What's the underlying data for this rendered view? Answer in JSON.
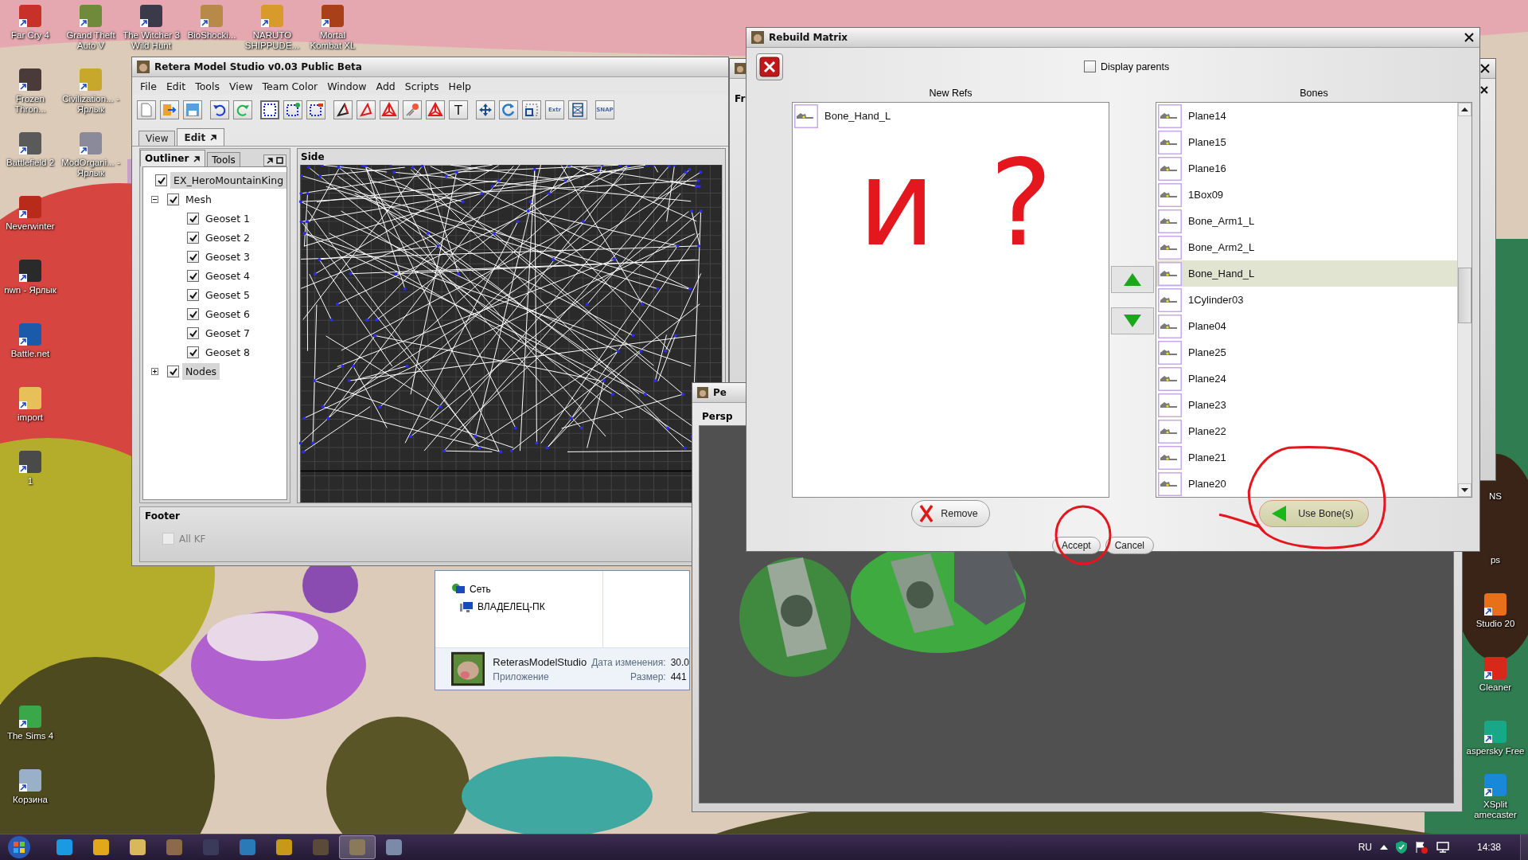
{
  "desktop_icons": [
    {
      "label": "Far Cry 4",
      "color": "#c8302a"
    },
    {
      "label": "Grand Theft Auto V",
      "color": "#6e8a3a"
    },
    {
      "label": "The Witcher 3 Wild Hunt",
      "color": "#3a3a4a"
    },
    {
      "label": "BioShocki...",
      "color": "#b88a4a"
    },
    {
      "label": "NARUTO SHIPPUDE...",
      "color": "#d89a2a"
    },
    {
      "label": "Mortal Kombat XL",
      "color": "#a8401a"
    },
    {
      "label": "Frozen Thron...",
      "color": "#4a3a3a"
    },
    {
      "label": "Civilization... - Ярлык",
      "color": "#c8a82a"
    },
    {
      "label": "Battlefield 2",
      "color": "#5a5a5a"
    },
    {
      "label": "ModOrgani... - Ярлык",
      "color": "#8a8a9a"
    },
    {
      "label": "Neverwinter",
      "color": "#b82a1a"
    },
    {
      "label": "nwn - Ярлык",
      "color": "#2a2a2a"
    },
    {
      "label": "Battle.net",
      "color": "#1a5aa8"
    },
    {
      "label": "import",
      "color": "#e8c05a"
    },
    {
      "label": "1",
      "color": "#4a4a4a"
    },
    {
      "label": "The Sims 4",
      "color": "#3aa84a"
    },
    {
      "label": "Корзина",
      "color": "#9ab0c8"
    }
  ],
  "right_icons": [
    {
      "label": "NS",
      "kind": "label"
    },
    {
      "label": "ps",
      "kind": "label"
    },
    {
      "label": "Studio 20",
      "kind": "shortcut",
      "color": "#e8701a"
    },
    {
      "label": "Cleaner",
      "kind": "shortcut",
      "color": "#d8281a"
    },
    {
      "label": "aspersky Free",
      "kind": "shortcut",
      "color": "#18a888"
    },
    {
      "label": "XSplit amecaster",
      "kind": "shortcut",
      "color": "#1a88d8"
    }
  ],
  "main_window": {
    "title": "Retera Model Studio v0.03 Public Beta",
    "menu": [
      "File",
      "Edit",
      "Tools",
      "View",
      "Team Color",
      "Window",
      "Add",
      "Scripts",
      "Help"
    ],
    "toolbar": [
      {
        "buttons": [
          {
            "kind": "new"
          },
          {
            "kind": "open"
          },
          {
            "kind": "save"
          }
        ]
      },
      {
        "buttons": [
          {
            "kind": "undo"
          },
          {
            "kind": "redo"
          }
        ]
      },
      {
        "buttons": [
          {
            "kind": "select",
            "selected": true
          },
          {
            "kind": "select-add",
            "selected": false
          },
          {
            "kind": "select-remove",
            "selected": false
          }
        ]
      },
      {
        "buttons": [
          {
            "kind": "vertex"
          },
          {
            "kind": "triangle"
          },
          {
            "kind": "tetra"
          },
          {
            "kind": "brush"
          },
          {
            "kind": "tetra"
          },
          {
            "kind": "text",
            "label": "T"
          }
        ]
      },
      {
        "buttons": [
          {
            "kind": "move"
          },
          {
            "kind": "rotate"
          },
          {
            "kind": "scale"
          },
          {
            "kind": "extrude",
            "label": "Extr"
          },
          {
            "kind": "extend"
          }
        ]
      },
      {
        "buttons": [
          {
            "kind": "snap",
            "label": "SNAP"
          }
        ]
      }
    ],
    "view_tabs": [
      {
        "label": "View",
        "selected": false
      },
      {
        "label": "Edit",
        "selected": true
      }
    ],
    "panel_tabs": [
      {
        "label": "Outliner",
        "selected": true
      },
      {
        "label": "Tools",
        "selected": false
      }
    ],
    "tree": [
      {
        "label": "EX_HeroMountainKing",
        "checked": true,
        "selected": true,
        "children": [
          {
            "label": "Mesh",
            "checked": true,
            "selected": false,
            "expanded": true,
            "children": [
              {
                "label": "Geoset 1",
                "checked": true,
                "selected": false
              },
              {
                "label": "Geoset 2",
                "checked": true,
                "selected": false
              },
              {
                "label": "Geoset 3",
                "checked": true,
                "selected": false
              },
              {
                "label": "Geoset 4",
                "checked": true,
                "selected": false
              },
              {
                "label": "Geoset 5",
                "checked": true,
                "selected": false
              },
              {
                "label": "Geoset 6",
                "checked": true,
                "selected": false
              },
              {
                "label": "Geoset 7",
                "checked": true,
                "selected": false
              },
              {
                "label": "Geoset 8",
                "checked": true,
                "selected": false
              }
            ]
          },
          {
            "label": "Nodes",
            "checked": true,
            "selected": true,
            "expanded": false
          }
        ]
      }
    ],
    "viewport": {
      "title": "Side"
    },
    "footer": {
      "title": "Footer",
      "all_kf": {
        "label": "All KF",
        "checked": false,
        "disabled": true
      }
    }
  },
  "back_window": {
    "panel_title": "Fr"
  },
  "perspective_window": {
    "title": "Pe",
    "panel_title": "Persp"
  },
  "explorer": {
    "tree": [
      {
        "label": "Сеть",
        "children": [
          {
            "label": "ВЛАДЕЛЕЦ-ПК"
          }
        ]
      }
    ],
    "details": {
      "name": "ReterasModelStudio",
      "type": "Приложение",
      "modified_label": "Дата изменения:",
      "modified": "30.0",
      "size_label": "Размер:",
      "size": "441"
    }
  },
  "dialog": {
    "title": "Rebuild Matrix",
    "display_parents": {
      "label": "Display parents",
      "checked": false
    },
    "new_refs": {
      "title": "New Refs",
      "items": [
        "Bone_Hand_L"
      ]
    },
    "bones": {
      "title": "Bones",
      "items": [
        {
          "label": "Plane14",
          "selected": false
        },
        {
          "label": "Plane15",
          "selected": false
        },
        {
          "label": "Plane16",
          "selected": false
        },
        {
          "label": "1Box09",
          "selected": false
        },
        {
          "label": "Bone_Arm1_L",
          "selected": false
        },
        {
          "label": "Bone_Arm2_L",
          "selected": false
        },
        {
          "label": "Bone_Hand_L",
          "selected": true
        },
        {
          "label": "1Cylinder03",
          "selected": false
        },
        {
          "label": "Plane04",
          "selected": false
        },
        {
          "label": "Plane25",
          "selected": false
        },
        {
          "label": "Plane24",
          "selected": false
        },
        {
          "label": "Plane23",
          "selected": false
        },
        {
          "label": "Plane22",
          "selected": false
        },
        {
          "label": "Plane21",
          "selected": false
        },
        {
          "label": "Plane20",
          "selected": false
        }
      ]
    },
    "remove": "Remove",
    "use_bones": "Use Bone(s)",
    "accept": "Accept",
    "cancel": "Cancel"
  },
  "annotations": {
    "text": "и ?",
    "marks": [
      {
        "kind": "ellipse"
      },
      {
        "kind": "loop"
      }
    ]
  },
  "taskbar": {
    "apps": [
      {
        "color": "#1a9ae0",
        "selected": false
      },
      {
        "color": "#e0a81a",
        "selected": false
      },
      {
        "color": "#d8b85a",
        "selected": false
      },
      {
        "color": "#8a6a4a",
        "selected": false
      },
      {
        "color": "#3a3a5a",
        "selected": false
      },
      {
        "color": "#2a7ab8",
        "selected": false
      },
      {
        "color": "#c8981a",
        "selected": false
      },
      {
        "color": "#5a4a3a",
        "selected": false
      },
      {
        "color": "#8a7a5a",
        "selected": true
      },
      {
        "color": "#7a8aa8",
        "selected": false
      }
    ],
    "language": "RU",
    "clock": "14:38"
  }
}
